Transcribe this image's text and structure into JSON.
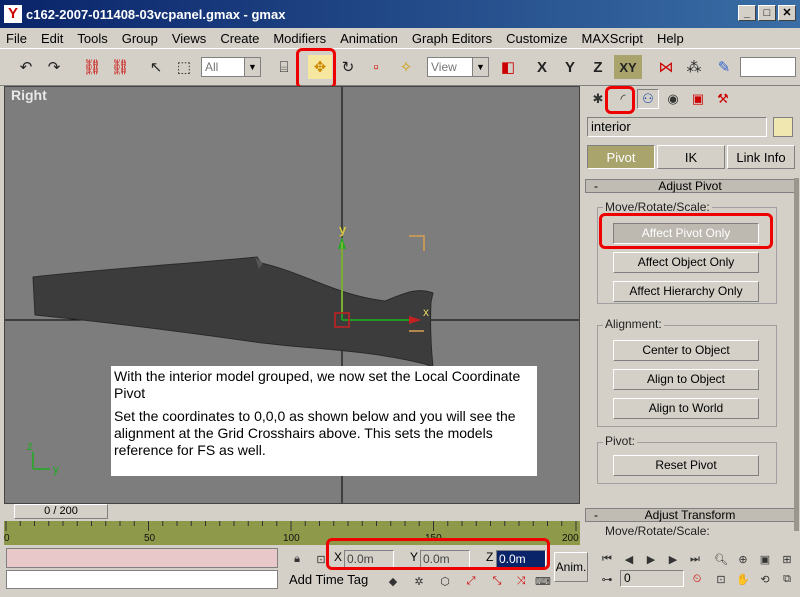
{
  "window": {
    "title": "c162-2007-011408-03vcpanel.gmax - gmax",
    "app_icon": "gmax-logo-icon",
    "buttons": [
      "_",
      "□",
      "✕"
    ]
  },
  "menu": [
    "File",
    "Edit",
    "Tools",
    "Group",
    "Views",
    "Create",
    "Modifiers",
    "Animation",
    "Graph Editors",
    "Customize",
    "MAXScript",
    "Help"
  ],
  "toolbar": {
    "selection_filter": "All",
    "ref_coord": "View",
    "axis_x": "X",
    "axis_y": "Y",
    "axis_z": "Z",
    "axis_xy": "XY",
    "highlight_color": "#e00000"
  },
  "viewport": {
    "label": "Right",
    "gizmo_y": "y",
    "gizmo_x": "x",
    "axis_z": "z",
    "axis_y": "y",
    "note_line1": "With the interior model grouped, we now set the Local Coordinate Pivot",
    "note_line2": "Set the coordinates to 0,0,0 as shown below and you will see the alignment at the Grid Crosshairs above.  This sets the models reference for FS as well."
  },
  "panel": {
    "object_name": "interior",
    "mode_pivot": "Pivot",
    "mode_ik": "IK",
    "mode_link": "Link Info",
    "adjust_pivot": {
      "title": "Adjust Pivot",
      "pm": "-",
      "group_move": "Move/Rotate/Scale:",
      "affect_pivot": "Affect Pivot Only",
      "affect_object": "Affect Object Only",
      "affect_hierarchy": "Affect Hierarchy Only",
      "group_alignment": "Alignment:",
      "center_to_object": "Center to Object",
      "align_to_object": "Align to Object",
      "align_to_world": "Align to World",
      "group_pivot": "Pivot:",
      "reset_pivot": "Reset Pivot"
    },
    "adjust_transform": {
      "title": "Adjust Transform",
      "pm": "-",
      "group_move": "Move/Rotate/Scale:"
    }
  },
  "timeline": {
    "slider": "0 / 200",
    "ticks": [
      "0",
      "50",
      "100",
      "150",
      "200"
    ]
  },
  "status": {
    "x_label": "X",
    "x_value": "0.0m",
    "y_label": "Y",
    "y_value": "0.0m",
    "z_label": "Z",
    "z_value": "0.0m",
    "add_time_tag": "Add Time Tag",
    "anim": "Anim.",
    "frame": "0"
  }
}
